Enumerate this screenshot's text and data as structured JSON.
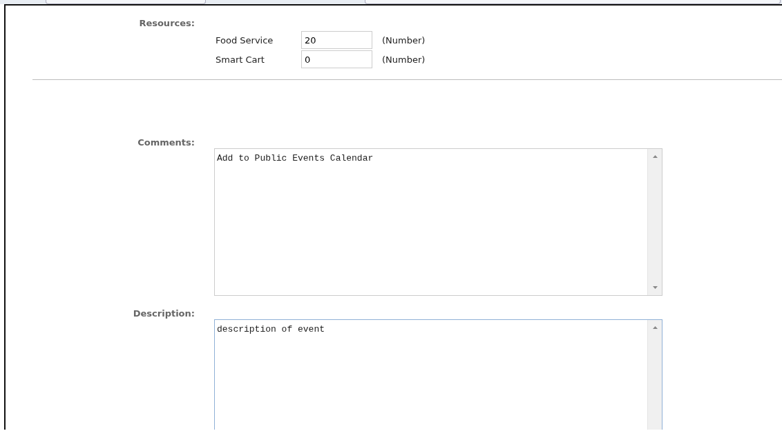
{
  "resources": {
    "label": "Resources:",
    "items": [
      {
        "name": "Food Service",
        "value": "20",
        "hint": "(Number)"
      },
      {
        "name": "Smart Cart",
        "value": "0",
        "hint": "(Number)"
      }
    ]
  },
  "text_areas": [
    {
      "label": "Comments:",
      "value": "Add to Public Events Calendar",
      "focused": false
    },
    {
      "label": "Description:",
      "value": "description of event",
      "focused": true
    }
  ]
}
